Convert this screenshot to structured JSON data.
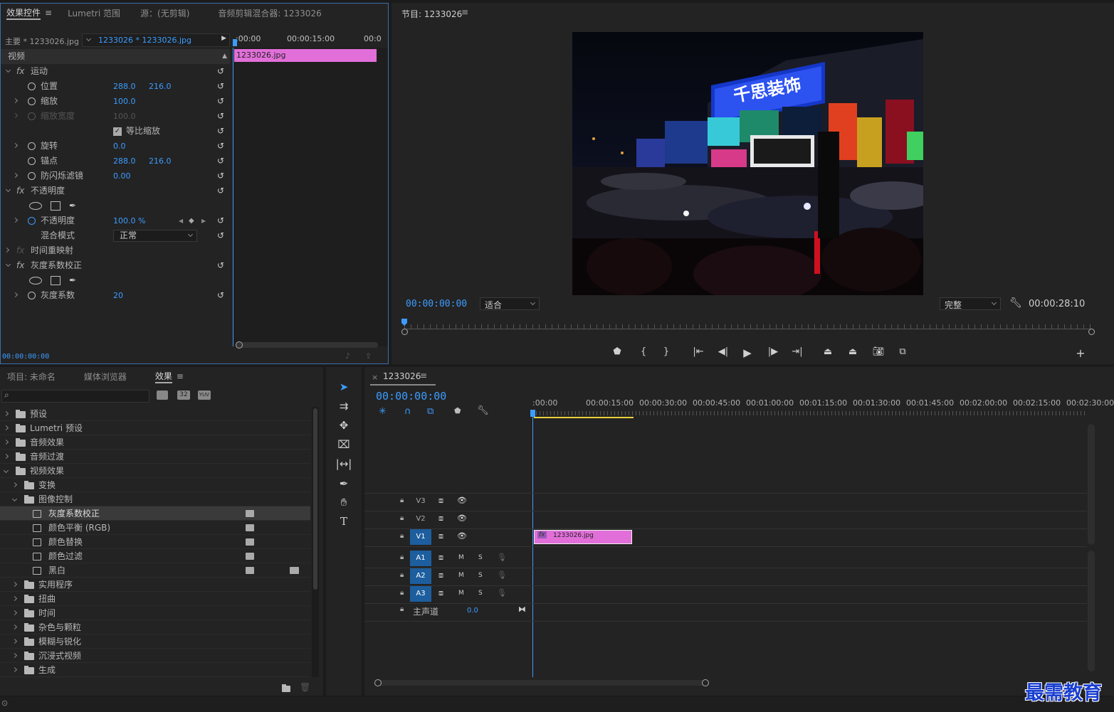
{
  "effect_controls": {
    "tabs": [
      "效果控件",
      "Lumetri 范围",
      "源：(无剪辑)",
      "音频剪辑混合器: 1233026"
    ],
    "master": "主要 * 1233026.jpg",
    "sequence_clip": "1233026 * 1233026.jpg",
    "ruler": {
      "t0": ":00:00",
      "t1": "00:00:15:00",
      "t2": "00:0"
    },
    "clip_name": "1233026.jpg",
    "section_video": "视频",
    "motion": "运动",
    "position": "位置",
    "position_x": "288.0",
    "position_y": "216.0",
    "scale": "缩放",
    "scale_value": "100.0",
    "scale_width": "缩放宽度",
    "scale_width_value": "100.0",
    "uniform_scale": "等比缩放",
    "rotation": "旋转",
    "rotation_value": "0.0",
    "anchor": "锚点",
    "anchor_x": "288.0",
    "anchor_y": "216.0",
    "antiflicker": "防闪烁滤镜",
    "antiflicker_value": "0.00",
    "opacity_group": "不透明度",
    "opacity": "不透明度",
    "opacity_value": "100.0 %",
    "blend_mode": "混合模式",
    "blend_value": "正常",
    "time_remap": "时间重映射",
    "gamma_group": "灰度系数校正",
    "gamma": "灰度系数",
    "gamma_value": "20",
    "footer_time": "00:00:00:00"
  },
  "program": {
    "title": "节目: 1233026",
    "timecode": "00:00:00:00",
    "fit": "适合",
    "quality": "完整",
    "duration": "00:00:28:10",
    "billboard_text": "千思装饰"
  },
  "project": {
    "tabs": [
      "项目: 未命名",
      "媒体浏览器",
      "效果"
    ],
    "items": [
      {
        "label": "预设",
        "level": 0,
        "expanded": false,
        "kind": "folder-star"
      },
      {
        "label": "Lumetri 预设",
        "level": 0,
        "expanded": false,
        "kind": "folder-star"
      },
      {
        "label": "音频效果",
        "level": 0,
        "expanded": false,
        "kind": "folder"
      },
      {
        "label": "音频过渡",
        "level": 0,
        "expanded": false,
        "kind": "folder"
      },
      {
        "label": "视频效果",
        "level": 0,
        "expanded": true,
        "kind": "folder"
      },
      {
        "label": "变换",
        "level": 1,
        "expanded": false,
        "kind": "folder"
      },
      {
        "label": "图像控制",
        "level": 1,
        "expanded": true,
        "kind": "folder"
      },
      {
        "label": "灰度系数校正",
        "level": 2,
        "kind": "effect",
        "selected": true
      },
      {
        "label": "颜色平衡 (RGB)",
        "level": 2,
        "kind": "effect"
      },
      {
        "label": "颜色替换",
        "level": 2,
        "kind": "effect"
      },
      {
        "label": "颜色过滤",
        "level": 2,
        "kind": "effect"
      },
      {
        "label": "黑白",
        "level": 2,
        "kind": "effect",
        "yuv": true
      },
      {
        "label": "实用程序",
        "level": 1,
        "expanded": false,
        "kind": "folder"
      },
      {
        "label": "扭曲",
        "level": 1,
        "expanded": false,
        "kind": "folder"
      },
      {
        "label": "时间",
        "level": 1,
        "expanded": false,
        "kind": "folder"
      },
      {
        "label": "杂色与颗粒",
        "level": 1,
        "expanded": false,
        "kind": "folder"
      },
      {
        "label": "模糊与锐化",
        "level": 1,
        "expanded": false,
        "kind": "folder"
      },
      {
        "label": "沉浸式视频",
        "level": 1,
        "expanded": false,
        "kind": "folder"
      },
      {
        "label": "生成",
        "level": 1,
        "expanded": false,
        "kind": "folder"
      }
    ],
    "badge_accel": "加速",
    "badge_32": "32",
    "badge_yuv": "YUV"
  },
  "timeline": {
    "title": "1233026",
    "timecode": "00:00:00:00",
    "ruler": [
      ":00:00",
      "00:00:15:00",
      "00:00:30:00",
      "00:00:45:00",
      "00:01:00:00",
      "00:01:15:00",
      "00:01:30:00",
      "00:01:45:00",
      "00:02:00:00",
      "00:02:15:00",
      "00:02:30:00"
    ],
    "video_tracks": [
      "V3",
      "V2",
      "V1"
    ],
    "audio_tracks": [
      "A1",
      "A2",
      "A3"
    ],
    "mute": "M",
    "solo": "S",
    "master_track": "主声道",
    "master_value": "0.0",
    "clip": "1233026.jpg"
  },
  "watermark": "最需教育"
}
